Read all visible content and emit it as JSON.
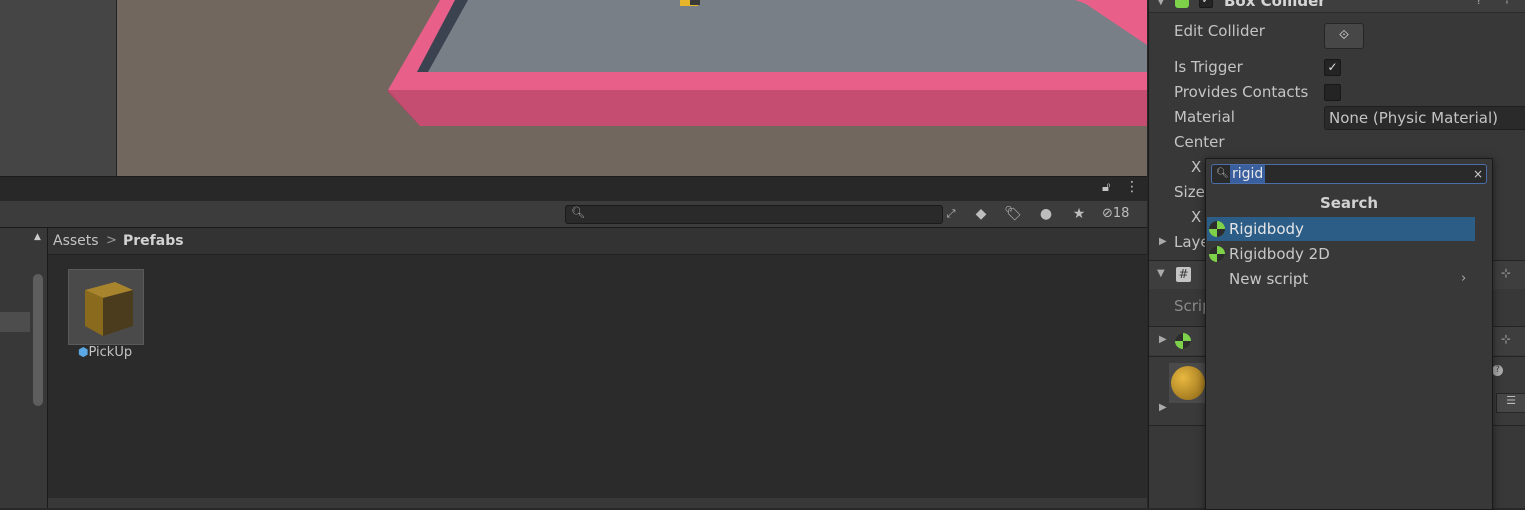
{
  "project": {
    "search_placeholder": "",
    "hidden_count": "18",
    "breadcrumb": {
      "root": "Assets",
      "separator": ">",
      "current": "Prefabs"
    },
    "assets": [
      {
        "name": "PickUp",
        "type": "prefab"
      }
    ]
  },
  "inspector": {
    "component_title": "Box Collider",
    "edit_collider_label": "Edit Collider",
    "is_trigger_label": "Is Trigger",
    "is_trigger_checked": true,
    "provides_contacts_label": "Provides Contacts",
    "provides_contacts_checked": false,
    "material_label": "Material",
    "material_value": "None (Physic Material)",
    "center_label": "Center",
    "center_x_label": "X",
    "size_label": "Size",
    "size_x_label": "X",
    "layer_overrides_label": "Laye",
    "script_label": "Scrip",
    "script_icon": "#"
  },
  "popup": {
    "search_value": "rigid",
    "header": "Search",
    "items": [
      {
        "label": "Rigidbody",
        "icon": "physics-component-icon",
        "selected": true
      },
      {
        "label": "Rigidbody 2D",
        "icon": "physics-component-icon",
        "selected": false
      },
      {
        "label": "New script",
        "icon": "",
        "selected": false,
        "submenu": true
      }
    ]
  },
  "colors": {
    "pink_border": "#e8608a",
    "floor": "#787f87",
    "selection": "#2c5d87",
    "component_green": "#7dd24a"
  }
}
